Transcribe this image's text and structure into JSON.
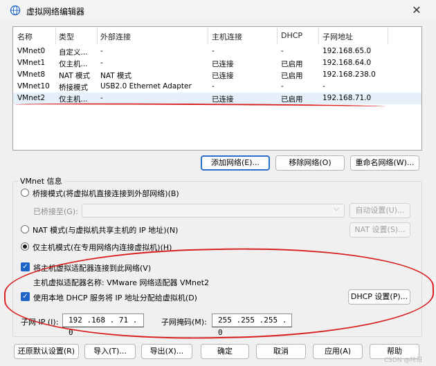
{
  "window": {
    "title": "虚拟网络编辑器",
    "close_glyph": "✕"
  },
  "table": {
    "headers": [
      "名称",
      "类型",
      "外部连接",
      "主机连接",
      "DHCP",
      "子网地址"
    ],
    "rows": [
      [
        "VMnet0",
        "自定义...",
        "-",
        "-",
        "-",
        "192.168.65.0"
      ],
      [
        "VMnet1",
        "仅主机...",
        "-",
        "已连接",
        "已启用",
        "192.168.64.0"
      ],
      [
        "VMnet8",
        "NAT 模式",
        "NAT 模式",
        "已连接",
        "已启用",
        "192.168.238.0"
      ],
      [
        "VMnet10",
        "桥接模式",
        "USB2.0 Ethernet Adapter",
        "-",
        "-",
        "-"
      ],
      [
        "VMnet2",
        "仅主机...",
        "-",
        "已连接",
        "已启用",
        "192.168.71.0"
      ]
    ],
    "selected_row": 4
  },
  "table_buttons": {
    "add": "添加网络(E)...",
    "remove": "移除网络(O)",
    "rename": "重命名网络(W)..."
  },
  "vmnet_info": {
    "group_label": "VMnet 信息",
    "bridge_mode": "桥接模式(将虚拟机直接连接到外部网络)(B)",
    "bridged_to_label": "已桥接至(G):",
    "auto_settings": "自动设置(U)...",
    "nat_mode": "NAT 模式(与虚拟机共享主机的 IP 地址)(N)",
    "nat_settings": "NAT 设置(S)...",
    "host_only": "仅主机模式(在专用网络内连接虚拟机)(H)",
    "connect_adapter": "将主机虚拟适配器连接到此网络(V)",
    "adapter_name": "主机虚拟适配器名称: VMware 网络适配器 VMnet2",
    "use_dhcp": "使用本地 DHCP 服务将 IP 地址分配给虚拟机(D)",
    "dhcp_settings": "DHCP 设置(P)...",
    "subnet_ip_label": "子网 IP (I):",
    "subnet_ip": "192 .168 . 71 . 0",
    "subnet_mask_label": "子网掩码(M):",
    "subnet_mask": "255 .255 .255 . 0",
    "check_glyph": "✓"
  },
  "bottom_buttons": {
    "restore": "还原默认设置(R)",
    "import": "导入(T)...",
    "export": "导出(X)...",
    "ok": "确定",
    "cancel": "取消",
    "apply": "应用(A)",
    "help": "帮助"
  },
  "watermark": "CSDN @咔哥",
  "colors": {
    "accent": "#1e63c6",
    "annotation_red": "#d81e1e",
    "selected_row": "#e5f0fb"
  }
}
